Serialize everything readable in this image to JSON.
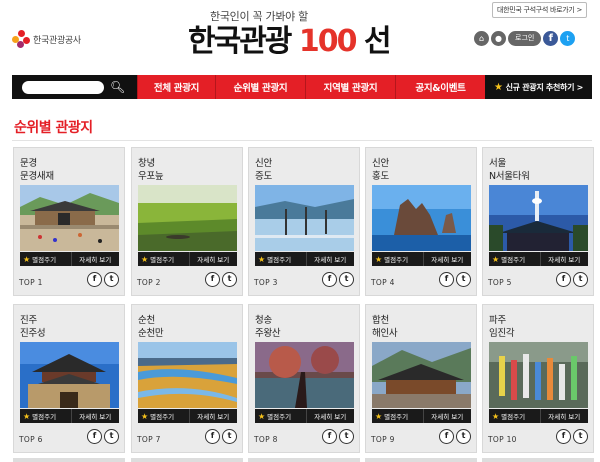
{
  "header": {
    "org_name": "한국관광공사",
    "tagline": "한국인이 꼭 가봐야 할",
    "brand_title": "한국관광",
    "brand_number": "100",
    "brand_suffix": "선",
    "korea_link": "대한민국 구석구석 바로가기 >",
    "login_label": "로그인",
    "icons": [
      "home-icon",
      "lock-icon",
      "facebook-icon",
      "twitter-icon"
    ]
  },
  "nav": {
    "search_placeholder": "",
    "items": [
      "전체 관광지",
      "순위별 관광지",
      "지역별 관광지",
      "공지&이벤트"
    ],
    "recommend_label": "신규 관광지 추천하기 >"
  },
  "section": {
    "title": "순위별 관광지"
  },
  "card_labels": {
    "star": "별점주기",
    "detail": "자세히 보기"
  },
  "cards": [
    {
      "region": "문경",
      "name": "문경새재",
      "rank": "TOP 1"
    },
    {
      "region": "창녕",
      "name": "우포늪",
      "rank": "TOP 2"
    },
    {
      "region": "신안",
      "name": "증도",
      "rank": "TOP 3"
    },
    {
      "region": "신안",
      "name": "홍도",
      "rank": "TOP 4"
    },
    {
      "region": "서울",
      "name": "N서울타워",
      "rank": "TOP 5"
    },
    {
      "region": "진주",
      "name": "진주성",
      "rank": "TOP 6"
    },
    {
      "region": "순천",
      "name": "순천만",
      "rank": "TOP 7"
    },
    {
      "region": "청송",
      "name": "주왕산",
      "rank": "TOP 8"
    },
    {
      "region": "합천",
      "name": "해인사",
      "rank": "TOP 9"
    },
    {
      "region": "파주",
      "name": "임진각",
      "rank": "TOP 10"
    }
  ],
  "colors": {
    "accent": "#e41f26",
    "nav_bg": "#111111",
    "card_bg": "#ebebeb",
    "star": "#f6c21b"
  }
}
